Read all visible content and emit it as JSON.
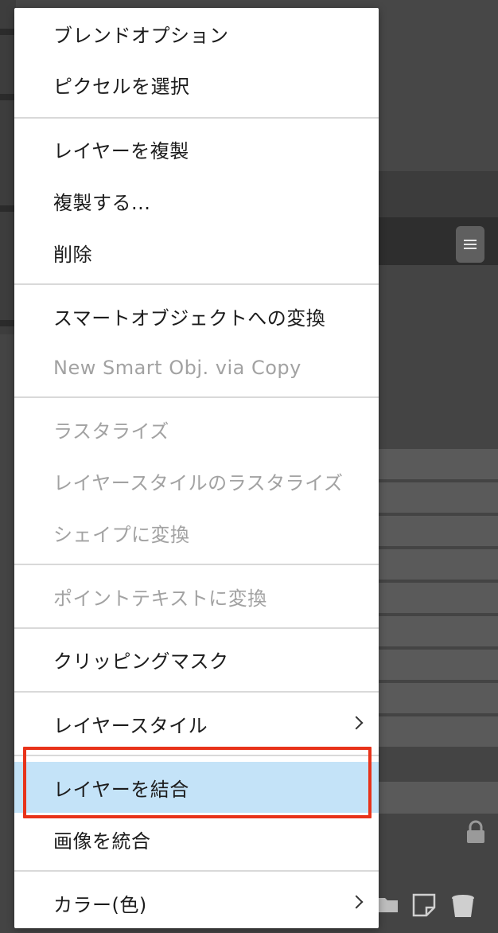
{
  "background": {
    "panel_button_icon": "hamburger-icon",
    "lock_icon": "lock-icon",
    "bottom_icons": [
      "folder-icon",
      "new-layer-icon",
      "trash-icon"
    ],
    "colors": {
      "panel": "#4a4a4a",
      "selected_row": "#2e2e2e"
    }
  },
  "menu": {
    "items": [
      {
        "label": "ブレンドオプション",
        "enabled": true
      },
      {
        "label": "ピクセルを選択",
        "enabled": true
      },
      {
        "label": "レイヤーを複製",
        "enabled": true
      },
      {
        "label": "複製する...",
        "enabled": true
      },
      {
        "label": "削除",
        "enabled": true
      },
      {
        "label": "スマートオブジェクトへの変換",
        "enabled": true
      },
      {
        "label": "New Smart Obj. via Copy",
        "enabled": false
      },
      {
        "label": "ラスタライズ",
        "enabled": false
      },
      {
        "label": "レイヤースタイルのラスタライズ",
        "enabled": false
      },
      {
        "label": "シェイプに変換",
        "enabled": false
      },
      {
        "label": "ポイントテキストに変換",
        "enabled": false
      },
      {
        "label": "クリッピングマスク",
        "enabled": true
      },
      {
        "label": "レイヤースタイル",
        "enabled": true,
        "submenu": true
      },
      {
        "label": "レイヤーを結合",
        "enabled": true,
        "highlighted": true
      },
      {
        "label": "画像を統合",
        "enabled": true
      },
      {
        "label": "カラー(色)",
        "enabled": true,
        "submenu": true
      }
    ],
    "colors": {
      "highlight": "#c4e3f8",
      "annotation": "#e8331a",
      "disabled_text": "#a2a2a2"
    }
  }
}
